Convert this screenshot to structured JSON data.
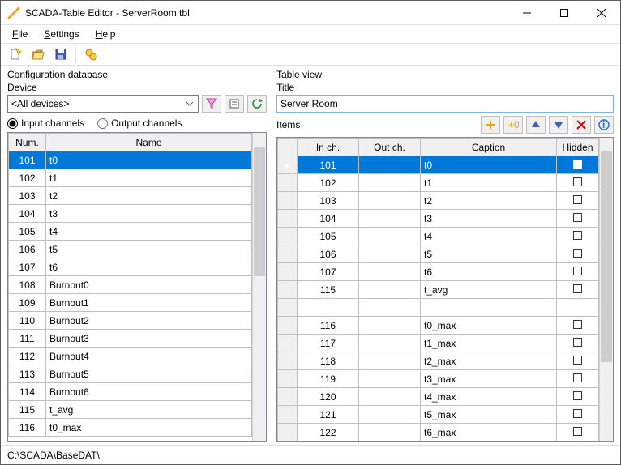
{
  "window": {
    "title": "SCADA-Table Editor - ServerRoom.tbl"
  },
  "menu": {
    "file": "File",
    "settings": "Settings",
    "help": "Help"
  },
  "left": {
    "panel_label": "Configuration database",
    "device_label": "Device",
    "device_value": "<All devices>",
    "radio_input": "Input channels",
    "radio_output": "Output channels",
    "headers": {
      "num": "Num.",
      "name": "Name"
    },
    "rows": [
      {
        "num": "101",
        "name": "t0",
        "sel": true
      },
      {
        "num": "102",
        "name": "t1"
      },
      {
        "num": "103",
        "name": "t2"
      },
      {
        "num": "104",
        "name": "t3"
      },
      {
        "num": "105",
        "name": "t4"
      },
      {
        "num": "106",
        "name": "t5"
      },
      {
        "num": "107",
        "name": "t6"
      },
      {
        "num": "108",
        "name": "Burnout0"
      },
      {
        "num": "109",
        "name": "Burnout1"
      },
      {
        "num": "110",
        "name": "Burnout2"
      },
      {
        "num": "111",
        "name": "Burnout3"
      },
      {
        "num": "112",
        "name": "Burnout4"
      },
      {
        "num": "113",
        "name": "Burnout5"
      },
      {
        "num": "114",
        "name": "Burnout6"
      },
      {
        "num": "115",
        "name": "t_avg"
      },
      {
        "num": "116",
        "name": "t0_max"
      }
    ]
  },
  "right": {
    "panel_label": "Table view",
    "title_label": "Title",
    "title_value": "Server Room",
    "items_label": "Items",
    "headers": {
      "in": "In ch.",
      "out": "Out ch.",
      "caption": "Caption",
      "hidden": "Hidden"
    },
    "rows": [
      {
        "in": "101",
        "out": "",
        "caption": "t0",
        "sel": true,
        "marker": true
      },
      {
        "in": "102",
        "out": "",
        "caption": "t1"
      },
      {
        "in": "103",
        "out": "",
        "caption": "t2"
      },
      {
        "in": "104",
        "out": "",
        "caption": "t3"
      },
      {
        "in": "105",
        "out": "",
        "caption": "t4"
      },
      {
        "in": "106",
        "out": "",
        "caption": "t5"
      },
      {
        "in": "107",
        "out": "",
        "caption": "t6"
      },
      {
        "in": "115",
        "out": "",
        "caption": "t_avg"
      },
      {
        "in": "",
        "out": "",
        "caption": "",
        "empty": true
      },
      {
        "in": "116",
        "out": "",
        "caption": "t0_max"
      },
      {
        "in": "117",
        "out": "",
        "caption": "t1_max"
      },
      {
        "in": "118",
        "out": "",
        "caption": "t2_max"
      },
      {
        "in": "119",
        "out": "",
        "caption": "t3_max"
      },
      {
        "in": "120",
        "out": "",
        "caption": "t4_max"
      },
      {
        "in": "121",
        "out": "",
        "caption": "t5_max"
      },
      {
        "in": "122",
        "out": "",
        "caption": "t6_max"
      }
    ]
  },
  "status": {
    "path": "C:\\SCADA\\BaseDAT\\"
  },
  "colors": {
    "accent": "#0078d7",
    "selected_bg": "#0078d7"
  }
}
